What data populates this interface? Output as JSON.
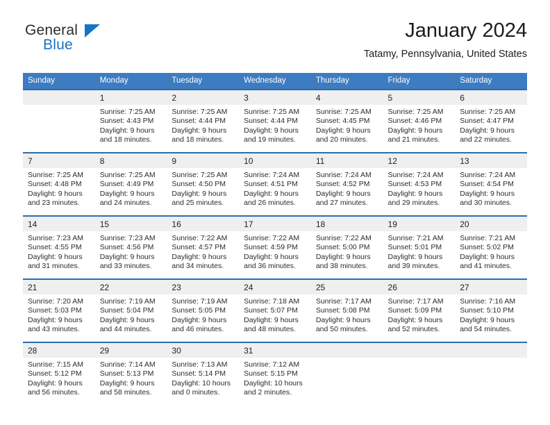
{
  "brand": {
    "name_part1": "General",
    "name_part2": "Blue",
    "triangle_color": "#1773c4",
    "text_color": "#2b2b2b"
  },
  "header": {
    "title": "January 2024",
    "subtitle": "Tatamy, Pennsylvania, United States"
  },
  "theme": {
    "header_row_bg": "#3d7cc0",
    "week_divider": "#2c6cb0",
    "daynum_bg": "#efefef",
    "text": "#2b2b2b"
  },
  "weekday_headers": [
    "Sunday",
    "Monday",
    "Tuesday",
    "Wednesday",
    "Thursday",
    "Friday",
    "Saturday"
  ],
  "weeks": [
    [
      {
        "day": "",
        "sunrise": "",
        "sunset": "",
        "daylight_line1": "",
        "daylight_line2": ""
      },
      {
        "day": "1",
        "sunrise": "Sunrise: 7:25 AM",
        "sunset": "Sunset: 4:43 PM",
        "daylight_line1": "Daylight: 9 hours",
        "daylight_line2": "and 18 minutes."
      },
      {
        "day": "2",
        "sunrise": "Sunrise: 7:25 AM",
        "sunset": "Sunset: 4:44 PM",
        "daylight_line1": "Daylight: 9 hours",
        "daylight_line2": "and 18 minutes."
      },
      {
        "day": "3",
        "sunrise": "Sunrise: 7:25 AM",
        "sunset": "Sunset: 4:44 PM",
        "daylight_line1": "Daylight: 9 hours",
        "daylight_line2": "and 19 minutes."
      },
      {
        "day": "4",
        "sunrise": "Sunrise: 7:25 AM",
        "sunset": "Sunset: 4:45 PM",
        "daylight_line1": "Daylight: 9 hours",
        "daylight_line2": "and 20 minutes."
      },
      {
        "day": "5",
        "sunrise": "Sunrise: 7:25 AM",
        "sunset": "Sunset: 4:46 PM",
        "daylight_line1": "Daylight: 9 hours",
        "daylight_line2": "and 21 minutes."
      },
      {
        "day": "6",
        "sunrise": "Sunrise: 7:25 AM",
        "sunset": "Sunset: 4:47 PM",
        "daylight_line1": "Daylight: 9 hours",
        "daylight_line2": "and 22 minutes."
      }
    ],
    [
      {
        "day": "7",
        "sunrise": "Sunrise: 7:25 AM",
        "sunset": "Sunset: 4:48 PM",
        "daylight_line1": "Daylight: 9 hours",
        "daylight_line2": "and 23 minutes."
      },
      {
        "day": "8",
        "sunrise": "Sunrise: 7:25 AM",
        "sunset": "Sunset: 4:49 PM",
        "daylight_line1": "Daylight: 9 hours",
        "daylight_line2": "and 24 minutes."
      },
      {
        "day": "9",
        "sunrise": "Sunrise: 7:25 AM",
        "sunset": "Sunset: 4:50 PM",
        "daylight_line1": "Daylight: 9 hours",
        "daylight_line2": "and 25 minutes."
      },
      {
        "day": "10",
        "sunrise": "Sunrise: 7:24 AM",
        "sunset": "Sunset: 4:51 PM",
        "daylight_line1": "Daylight: 9 hours",
        "daylight_line2": "and 26 minutes."
      },
      {
        "day": "11",
        "sunrise": "Sunrise: 7:24 AM",
        "sunset": "Sunset: 4:52 PM",
        "daylight_line1": "Daylight: 9 hours",
        "daylight_line2": "and 27 minutes."
      },
      {
        "day": "12",
        "sunrise": "Sunrise: 7:24 AM",
        "sunset": "Sunset: 4:53 PM",
        "daylight_line1": "Daylight: 9 hours",
        "daylight_line2": "and 29 minutes."
      },
      {
        "day": "13",
        "sunrise": "Sunrise: 7:24 AM",
        "sunset": "Sunset: 4:54 PM",
        "daylight_line1": "Daylight: 9 hours",
        "daylight_line2": "and 30 minutes."
      }
    ],
    [
      {
        "day": "14",
        "sunrise": "Sunrise: 7:23 AM",
        "sunset": "Sunset: 4:55 PM",
        "daylight_line1": "Daylight: 9 hours",
        "daylight_line2": "and 31 minutes."
      },
      {
        "day": "15",
        "sunrise": "Sunrise: 7:23 AM",
        "sunset": "Sunset: 4:56 PM",
        "daylight_line1": "Daylight: 9 hours",
        "daylight_line2": "and 33 minutes."
      },
      {
        "day": "16",
        "sunrise": "Sunrise: 7:22 AM",
        "sunset": "Sunset: 4:57 PM",
        "daylight_line1": "Daylight: 9 hours",
        "daylight_line2": "and 34 minutes."
      },
      {
        "day": "17",
        "sunrise": "Sunrise: 7:22 AM",
        "sunset": "Sunset: 4:59 PM",
        "daylight_line1": "Daylight: 9 hours",
        "daylight_line2": "and 36 minutes."
      },
      {
        "day": "18",
        "sunrise": "Sunrise: 7:22 AM",
        "sunset": "Sunset: 5:00 PM",
        "daylight_line1": "Daylight: 9 hours",
        "daylight_line2": "and 38 minutes."
      },
      {
        "day": "19",
        "sunrise": "Sunrise: 7:21 AM",
        "sunset": "Sunset: 5:01 PM",
        "daylight_line1": "Daylight: 9 hours",
        "daylight_line2": "and 39 minutes."
      },
      {
        "day": "20",
        "sunrise": "Sunrise: 7:21 AM",
        "sunset": "Sunset: 5:02 PM",
        "daylight_line1": "Daylight: 9 hours",
        "daylight_line2": "and 41 minutes."
      }
    ],
    [
      {
        "day": "21",
        "sunrise": "Sunrise: 7:20 AM",
        "sunset": "Sunset: 5:03 PM",
        "daylight_line1": "Daylight: 9 hours",
        "daylight_line2": "and 43 minutes."
      },
      {
        "day": "22",
        "sunrise": "Sunrise: 7:19 AM",
        "sunset": "Sunset: 5:04 PM",
        "daylight_line1": "Daylight: 9 hours",
        "daylight_line2": "and 44 minutes."
      },
      {
        "day": "23",
        "sunrise": "Sunrise: 7:19 AM",
        "sunset": "Sunset: 5:05 PM",
        "daylight_line1": "Daylight: 9 hours",
        "daylight_line2": "and 46 minutes."
      },
      {
        "day": "24",
        "sunrise": "Sunrise: 7:18 AM",
        "sunset": "Sunset: 5:07 PM",
        "daylight_line1": "Daylight: 9 hours",
        "daylight_line2": "and 48 minutes."
      },
      {
        "day": "25",
        "sunrise": "Sunrise: 7:17 AM",
        "sunset": "Sunset: 5:08 PM",
        "daylight_line1": "Daylight: 9 hours",
        "daylight_line2": "and 50 minutes."
      },
      {
        "day": "26",
        "sunrise": "Sunrise: 7:17 AM",
        "sunset": "Sunset: 5:09 PM",
        "daylight_line1": "Daylight: 9 hours",
        "daylight_line2": "and 52 minutes."
      },
      {
        "day": "27",
        "sunrise": "Sunrise: 7:16 AM",
        "sunset": "Sunset: 5:10 PM",
        "daylight_line1": "Daylight: 9 hours",
        "daylight_line2": "and 54 minutes."
      }
    ],
    [
      {
        "day": "28",
        "sunrise": "Sunrise: 7:15 AM",
        "sunset": "Sunset: 5:12 PM",
        "daylight_line1": "Daylight: 9 hours",
        "daylight_line2": "and 56 minutes."
      },
      {
        "day": "29",
        "sunrise": "Sunrise: 7:14 AM",
        "sunset": "Sunset: 5:13 PM",
        "daylight_line1": "Daylight: 9 hours",
        "daylight_line2": "and 58 minutes."
      },
      {
        "day": "30",
        "sunrise": "Sunrise: 7:13 AM",
        "sunset": "Sunset: 5:14 PM",
        "daylight_line1": "Daylight: 10 hours",
        "daylight_line2": "and 0 minutes."
      },
      {
        "day": "31",
        "sunrise": "Sunrise: 7:12 AM",
        "sunset": "Sunset: 5:15 PM",
        "daylight_line1": "Daylight: 10 hours",
        "daylight_line2": "and 2 minutes."
      },
      {
        "day": "",
        "sunrise": "",
        "sunset": "",
        "daylight_line1": "",
        "daylight_line2": ""
      },
      {
        "day": "",
        "sunrise": "",
        "sunset": "",
        "daylight_line1": "",
        "daylight_line2": ""
      },
      {
        "day": "",
        "sunrise": "",
        "sunset": "",
        "daylight_line1": "",
        "daylight_line2": ""
      }
    ]
  ]
}
